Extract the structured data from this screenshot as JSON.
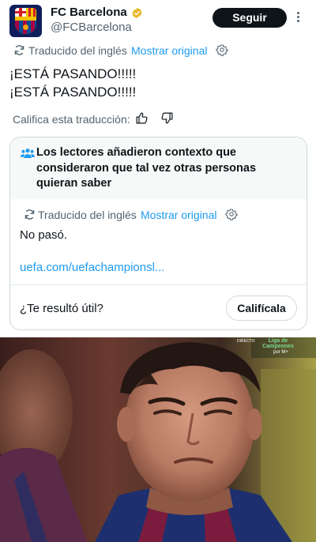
{
  "post": {
    "author_name": "FC Barcelona",
    "author_handle": "@FCBarcelona",
    "follow_label": "Seguir",
    "translated_label": "Traducido del inglés",
    "show_original_label": "Mostrar original",
    "text_line1": "¡ESTÁ PASANDO!!!!!",
    "text_line2": "¡ESTÁ PASANDO!!!!!",
    "rate_translation_label": "Califica esta traducción:"
  },
  "community_note": {
    "title": "Los lectores añadieron contexto que consideraron que tal vez otras personas quieran saber",
    "translated_label": "Traducido del inglés",
    "show_original_label": "Mostrar original",
    "body": "No pasó.",
    "link_text": "uefa.com/uefachampionsl...",
    "useful_question": "¿Te resultó útil?",
    "rate_button_label": "Califícala"
  },
  "media": {
    "broadcast_tag": "DIRECTO",
    "competition": "Liga de Campeones",
    "channel": "por M+"
  },
  "colors": {
    "accent_link": "#1d9bf0",
    "follow_button_bg": "#0f1419",
    "secondary_text": "#536471",
    "note_header_bg": "#f7f9f9",
    "verified_badge": "#e8b827"
  },
  "icons": [
    "verified-badge-icon",
    "more-options-icon",
    "translate-icon",
    "settings-gear-icon",
    "thumbs-up-icon",
    "thumbs-down-icon",
    "people-icon"
  ]
}
